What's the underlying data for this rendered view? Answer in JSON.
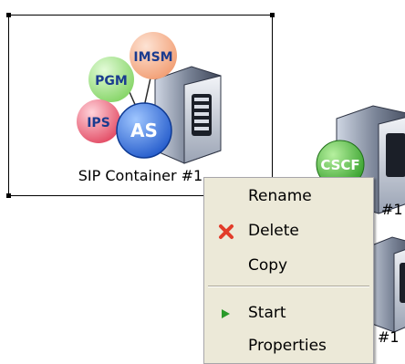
{
  "nodes": {
    "sip_container": {
      "label": "SIP Container #1",
      "bubbles": {
        "imsm": "IMSM",
        "pgm": "PGM",
        "ips": "IPS",
        "as": "AS"
      }
    },
    "cscf": {
      "badge": "CSCF",
      "suffix": "#1"
    },
    "second": {
      "suffix": "#1"
    }
  },
  "context_menu": {
    "items": [
      {
        "label": "Rename",
        "icon": ""
      },
      {
        "label": "Delete",
        "icon": "red-x-icon"
      },
      {
        "label": "Copy",
        "icon": ""
      },
      {
        "label": "Start",
        "icon": "green-play-icon"
      },
      {
        "label": "Properties",
        "icon": ""
      }
    ]
  },
  "colors": {
    "menu_bg": "#ece9d8",
    "delete_red": "#e23c2a",
    "start_green": "#2a9a2a",
    "ips_red": "#e8556a",
    "pgm_green": "#8fdc73",
    "imsm_orange": "#f6b08a",
    "as_blue": "#2f6fd9",
    "cscf_green": "#3caa2f"
  }
}
